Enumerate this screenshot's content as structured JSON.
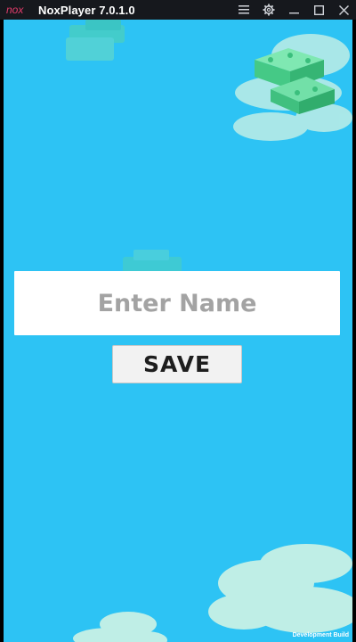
{
  "window": {
    "title": "NoxPlayer 7.0.1.0",
    "logo_text": "nox",
    "controls": [
      {
        "name": "menu-icon"
      },
      {
        "name": "settings-gear-icon"
      },
      {
        "name": "minimize-icon"
      },
      {
        "name": "maximize-icon"
      },
      {
        "name": "close-icon"
      }
    ]
  },
  "form": {
    "name_placeholder": "Enter Name",
    "name_value": "",
    "save_label": "SAVE"
  },
  "footer": {
    "build_label": "Development Build"
  },
  "colors": {
    "titlebar": "#16181d",
    "sky": "#2dc3f4",
    "cloud": "#bfeee6",
    "block": "#5fd99a",
    "logo": "#e33c6b"
  }
}
